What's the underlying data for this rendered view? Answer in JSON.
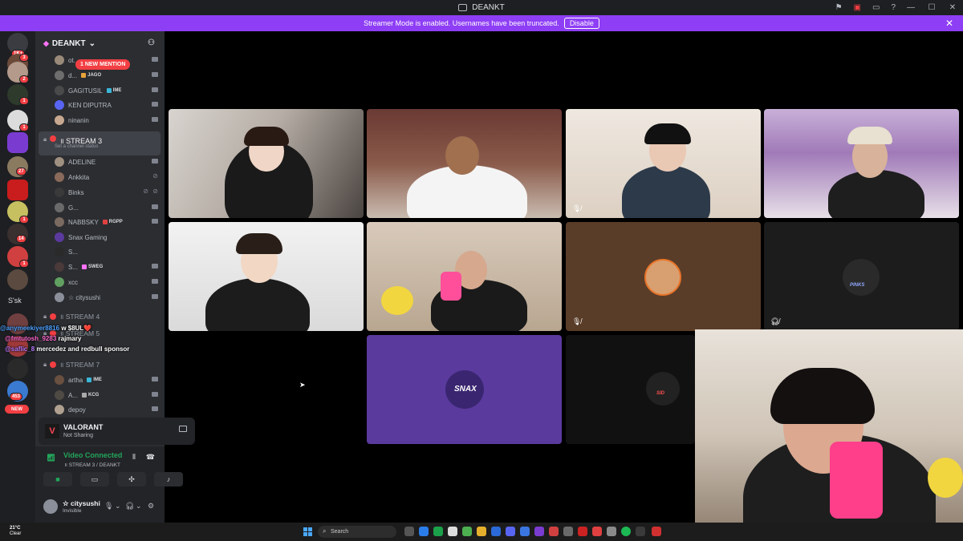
{
  "window": {
    "title": "DEANKT",
    "controls": [
      "—",
      "☐",
      "✕"
    ]
  },
  "banner": {
    "message": "Streamer Mode is enabled. Usernames have been truncated.",
    "disable_label": "Disable"
  },
  "rail": {
    "badges": [
      "1K+",
      "3",
      "2",
      "1",
      "1",
      "27",
      "1",
      "14",
      "1",
      "453"
    ],
    "new_label": "NEW",
    "sk_label": "S'sk"
  },
  "sidebar": {
    "server_name": "DEANKT",
    "mention_label": "1 NEW MENTION",
    "top_members": [
      {
        "name": "ot..."
      },
      {
        "name": "d...",
        "tag": "JAGO"
      },
      {
        "name": "GAGITUSIL",
        "tag": "IME"
      },
      {
        "name": "KEN DIPUTRA"
      },
      {
        "name": "ninanin"
      }
    ],
    "stream3": {
      "name": "॥ STREAM 3",
      "status": "Set a channel status"
    },
    "stream3_members": [
      {
        "name": "ADELINE"
      },
      {
        "name": "Ankkita"
      },
      {
        "name": "Binks"
      },
      {
        "name": "G..."
      },
      {
        "name": "NABBSKY",
        "tag": "RGPP"
      },
      {
        "name": "Snax Gaming"
      },
      {
        "name": "S..."
      },
      {
        "name": "S...",
        "tag": "SWEG"
      },
      {
        "name": "xcc"
      },
      {
        "name": "☆ citysushi"
      }
    ],
    "stream4": "॥ STREAM 4",
    "stream5": "॥ STREAM 5",
    "stream7": "॥ STREAM 7",
    "stream7_members": [
      {
        "name": "artha",
        "tag": "IME"
      },
      {
        "name": "A...",
        "tag": "KCG"
      },
      {
        "name": "depoy"
      }
    ]
  },
  "chat_overlay": [
    {
      "user": "@anymeekiyer8816",
      "text": "w $8UL❤️"
    },
    {
      "user": "@fmtutosh_9283",
      "text": "rajmary"
    },
    {
      "user": "@saflic_8",
      "text": "mercedez and redbull sponsor"
    }
  ],
  "activity": {
    "game": "VALORANT",
    "status": "Not Sharing"
  },
  "voice": {
    "status": "Video Connected",
    "channel": "॥ STREAM 3 / DEANKT"
  },
  "user": {
    "name": "☆ citysushi",
    "status": "Invisible"
  },
  "tiles": {
    "snax_label": "SNAX",
    "pinks_label": "PINKS",
    "sid_label": "SID"
  },
  "taskbar": {
    "temp": "21°C",
    "weather": "Clear",
    "search": "Search"
  },
  "colors": {
    "banner": "#8e3ef5",
    "live": "#f23f43",
    "connected": "#23a55a",
    "snax_tile": "#5b3a9e"
  }
}
